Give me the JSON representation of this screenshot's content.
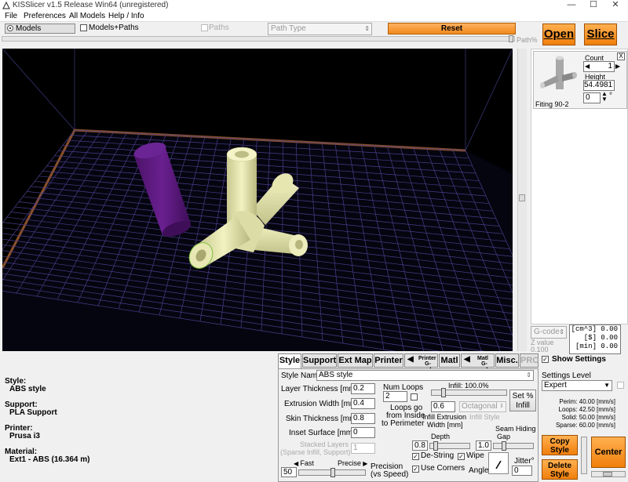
{
  "window": {
    "title": "KISSlicer v1.5 Release Win64 (unregistered)",
    "minimize": "—",
    "maximize": "☐",
    "close": "✕"
  },
  "menu": [
    "File",
    "Preferences",
    "All Models",
    "Help / Info"
  ],
  "toolbar": {
    "models_label": "Models",
    "models_paths_label": "Models+Paths",
    "paths_label": "Paths",
    "path_type": "Path Type",
    "reset_label": "Reset",
    "path_pct_label": "Path%",
    "open_label": "Open",
    "slice_label": "Slice"
  },
  "model": {
    "name": "Fiting 90-2",
    "count_label": "Count",
    "count": "1",
    "close_x": "X",
    "height_label": "Height",
    "height": "54.4981",
    "angle": "0",
    "degree": "°"
  },
  "gcode": {
    "selector": "G-code",
    "z_label": "Z value",
    "z_value": "0.100",
    "stats": [
      "[cm^3] 0.00",
      "[$] 0.00",
      "[min] 0.00"
    ]
  },
  "show_settings_label": "Show Settings",
  "settings_level": {
    "label": "Settings Level",
    "value": "Expert"
  },
  "speeds": [
    "Perim: 40.00 [mm/s]",
    "Loops: 42.50 [mm/s]",
    "Solid: 50.00 [mm/s]",
    "Sparse: 60.00 [mm/s]"
  ],
  "buttons": {
    "copy_style": [
      "Copy",
      "Style"
    ],
    "delete_style": [
      "Delete",
      "Style"
    ],
    "center": "Center"
  },
  "info": {
    "style_label": "Style:",
    "style_value": "ABS style",
    "support_label": "Support:",
    "support_value": "PLA Support",
    "printer_label": "Printer:",
    "printer_value": "Prusa i3",
    "material_label": "Material:",
    "material_value": "Ext1 - ABS (16.364 m)"
  },
  "tabs": {
    "style": "Style",
    "support": "Support",
    "ext_map": "Ext Map",
    "printer": "Printer",
    "printer_gcode_top": "Printer",
    "printer_gcode_bottom": "G-code",
    "matl": "Matl",
    "matl_gcode_top": "Matl",
    "matl_gcode_bottom": "G-code",
    "misc": "Misc.",
    "pro": "PRO"
  },
  "style_settings": {
    "style_name_label": "Style Name",
    "style_name": "ABS style",
    "layer_thickness_label": "Layer Thickness [mm]",
    "layer_thickness": "0.2",
    "extrusion_width_label": "Extrusion Width [mm]",
    "extrusion_width": "0.4",
    "skin_thickness_label": "Skin Thickness [mm]",
    "skin_thickness": "0.8",
    "inset_surface_label": "Inset  Surface [mm]",
    "inset_surface": "0",
    "stacked_layers_label_1": "Stacked Layers",
    "stacked_layers_label_2": "(Sparse Infill, Support)",
    "stacked_layers": "1",
    "fast_label": "Fast",
    "precise_label": "Precise",
    "speed_value": "50",
    "precision_label_1": "Precision",
    "precision_label_2": "(vs  Speed)",
    "num_loops_label": "Num Loops",
    "num_loops": "2",
    "loops_inside_1": "Loops go",
    "loops_inside_2": "from Inside",
    "loops_inside_3": "to Perimeter",
    "infill_label": "Infill: 100.0%",
    "infill_width": "0.6",
    "infill_width_label_1": "Infill Extrusion",
    "infill_width_label_2": "Width [mm]",
    "infill_style_value": "Octagonal",
    "infill_style_label": "Infill Style",
    "set_infill_1": "Set %",
    "set_infill_2": "Infill",
    "seam_hiding_label_1": "Seam Hiding",
    "seam_hiding_label_2": "Gap",
    "depth_label": "Depth",
    "depth_value": "0.8",
    "gap_value": "1.0",
    "destring_label": "De-String",
    "wipe_label": "Wipe",
    "use_corners_label": "Use Corners",
    "angle_label": "Angle",
    "jitter_label": "Jitter°",
    "jitter_value": "0"
  },
  "colors": {
    "accent_orange": "#f28a1c",
    "viewport_bg": "#000000",
    "model_color": "#eeeeb0",
    "cylinder_color": "#5c1a7a",
    "grid_color": "#5a4a9a"
  }
}
